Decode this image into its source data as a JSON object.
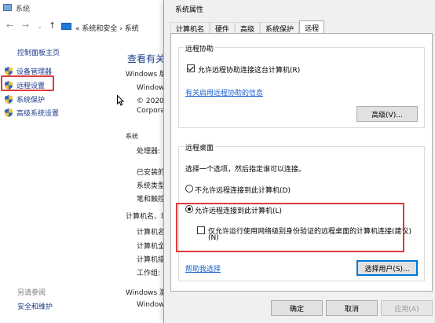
{
  "bg_window": {
    "title": "系统",
    "nav": {
      "back": "←",
      "forward": "→",
      "down": "⌄",
      "up": "↑",
      "address": "« 系统和安全 › 系统"
    }
  },
  "sidebar": {
    "home": "控制面板主页",
    "items": [
      {
        "label": "设备管理器",
        "icon": "shield-icon"
      },
      {
        "label": "远程设置",
        "icon": "shield-icon"
      },
      {
        "label": "系统保护",
        "icon": "shield-icon"
      },
      {
        "label": "高级系统设置",
        "icon": "shield-icon"
      }
    ],
    "see_also": "另请参阅",
    "security": "安全和维护"
  },
  "main": {
    "title": "查看有关",
    "edition_head": "Windows 版",
    "edition_line1": "Window",
    "edition_line2": "© 2020",
    "edition_line3": "Corpora",
    "system_head": "系统",
    "processor": "处理器:",
    "installed": "已安装的",
    "sys_type": "系统类型",
    "pen": "笔和触控",
    "computer_head": "计算机名、域",
    "comp_name": "计算机名",
    "comp_full": "计算机全",
    "comp_desc": "计算机描",
    "workgroup": "工作组:",
    "activation_head": "Windows 激",
    "activation_line": "Window"
  },
  "dialog": {
    "title": "系统属性",
    "tabs": [
      "计算机名",
      "硬件",
      "高级",
      "系统保护",
      "远程"
    ],
    "active_tab": "远程",
    "assist": {
      "legend": "远程协助",
      "allow_label": "允许远程协助连接这台计算机(R)",
      "allow_checked": true,
      "info_link": "有关启用远程协助的信息",
      "advanced_btn": "高级(V)..."
    },
    "desktop": {
      "legend": "远程桌面",
      "prompt": "选择一个选项，然后指定谁可以连接。",
      "deny_label": "不允许远程连接到此计算机(D)",
      "allow_label": "允许远程连接到此计算机(L)",
      "selected": "allow",
      "nla_label_line1": "仅允许运行使用网络级别身份验证的远程桌面的计算机连接(建议)",
      "nla_label_line2": "(N)",
      "nla_checked": false,
      "help_link": "帮助我选择",
      "select_users_btn": "选择用户(S)..."
    },
    "ok_btn": "确定",
    "cancel_btn": "取消",
    "apply_btn": "应用(A)"
  },
  "colors": {
    "accent": "#0078d7",
    "highlight": "#e0393b",
    "link": "#1a5fcf"
  }
}
